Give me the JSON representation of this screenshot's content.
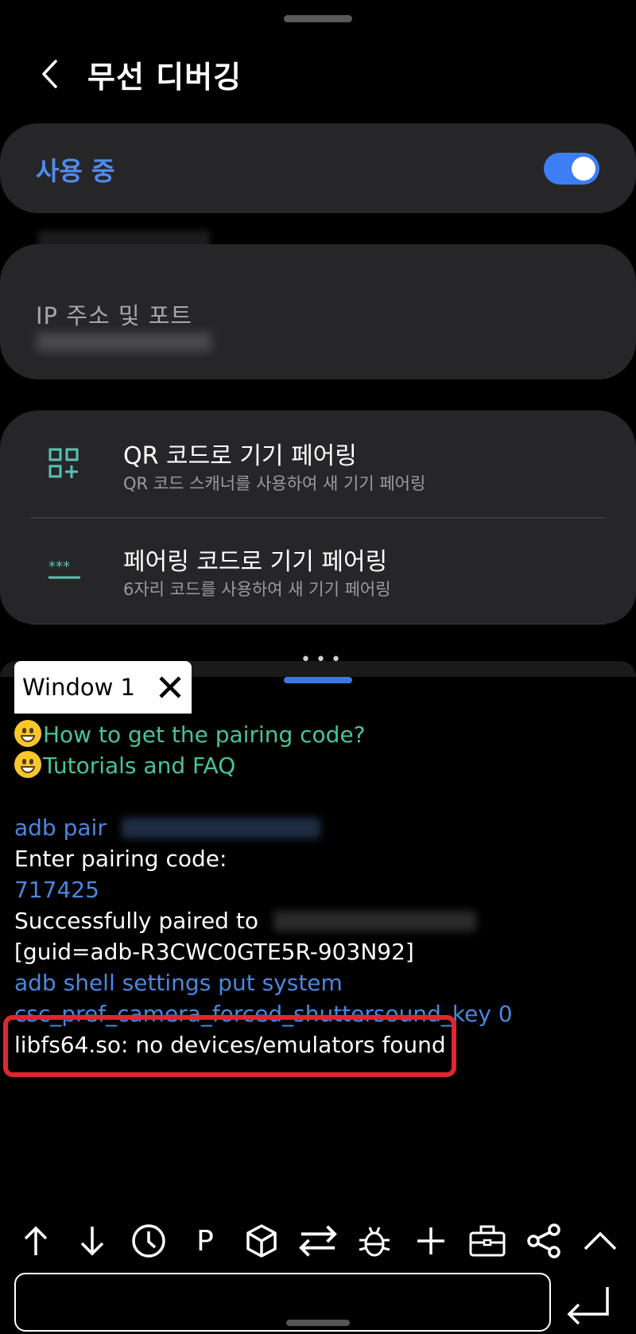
{
  "header": {
    "title": "무선 디버깅"
  },
  "toggle": {
    "label": "사용 중",
    "state": "on"
  },
  "ip": {
    "label": "IP 주소 및 포트"
  },
  "pairing": {
    "qr": {
      "title": "QR 코드로 기기 페어링",
      "subtitle": "QR 코드 스캐너를 사용하여 새 기기 페어링"
    },
    "code": {
      "title": "페어링 코드로 기기 페어링",
      "subtitle": "6자리 코드를 사용하여 새 기기 페어링",
      "icon_text": "***"
    }
  },
  "terminal": {
    "tab_label": "Window 1",
    "help_links": [
      "How to get the pairing code?",
      "Tutorials and FAQ"
    ],
    "lines": {
      "pair_cmd": "adb  pair",
      "enter_code": "Enter pairing code:",
      "code": "717425",
      "paired": "Successfully paired to",
      "guid": "[guid=adb-R3CWC0GTE5R-903N92]",
      "cmd1": "adb shell settings put system",
      "cmd2": "csc_pref_camera_forced_shuttersound_key 0",
      "error": "libfs64.so: no devices/emulators found"
    }
  },
  "toolbar": {
    "items": [
      "arrow-up",
      "arrow-down",
      "history",
      "P",
      "adb",
      "switch",
      "debug",
      "add",
      "toolbox",
      "share",
      "collapse"
    ],
    "p_label": "P"
  },
  "colors": {
    "accent": "#3e7ef4",
    "link_green": "#48c49a",
    "command_blue": "#4a88df",
    "highlight_red": "#e02631"
  }
}
